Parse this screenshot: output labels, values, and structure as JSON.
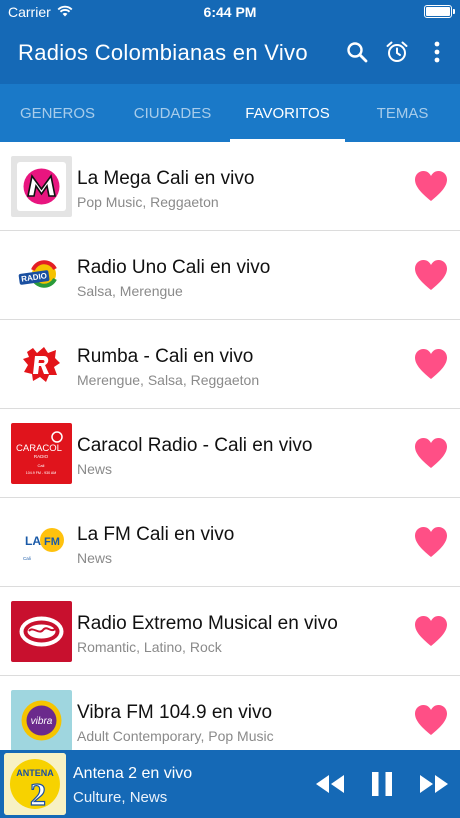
{
  "status_bar": {
    "carrier": "Carrier",
    "time": "6:44 PM",
    "icons": [
      "wifi-icon",
      "battery-icon"
    ]
  },
  "app_bar": {
    "title": "Radios Colombianas en Vivo",
    "icons": [
      "search-icon",
      "alarm-clock-icon",
      "more-vertical-icon"
    ]
  },
  "tabs": [
    {
      "label": "GENEROS",
      "active": false
    },
    {
      "label": "CIUDADES",
      "active": false
    },
    {
      "label": "FAVORITOS",
      "active": true
    },
    {
      "label": "TEMAS",
      "active": false
    }
  ],
  "stations": [
    {
      "name": "La Mega Cali en vivo",
      "genres": "Pop Music, Reggaeton",
      "logo_icon": "la-mega-logo",
      "favorite": true
    },
    {
      "name": "Radio Uno Cali en vivo",
      "genres": "Salsa, Merengue",
      "logo_icon": "radio-uno-logo",
      "favorite": true
    },
    {
      "name": "Rumba - Cali en vivo",
      "genres": "Merengue, Salsa, Reggaeton",
      "logo_icon": "rumba-logo",
      "favorite": true
    },
    {
      "name": "Caracol Radio - Cali en vivo",
      "genres": "News",
      "logo_icon": "caracol-radio-logo",
      "favorite": true
    },
    {
      "name": "La FM Cali en vivo",
      "genres": "News",
      "logo_icon": "la-fm-logo",
      "favorite": true
    },
    {
      "name": "Radio Extremo Musical en vivo",
      "genres": "Romantic, Latino, Rock",
      "logo_icon": "radio-extremo-logo",
      "favorite": true
    },
    {
      "name": "Vibra FM 104.9 en vivo",
      "genres": "Adult Contemporary, Pop Music",
      "logo_icon": "vibra-fm-logo",
      "favorite": true
    }
  ],
  "player": {
    "name": "Antena 2 en vivo",
    "genres": "Culture, News",
    "art_icon": "antena-2-logo",
    "controls": [
      "rewind-icon",
      "pause-icon",
      "fast-forward-icon"
    ]
  },
  "colors": {
    "primary": "#1569b6",
    "tab_bar": "#1a79c8",
    "heart": "#ff4f86",
    "text_secondary": "#8a8a8a"
  }
}
